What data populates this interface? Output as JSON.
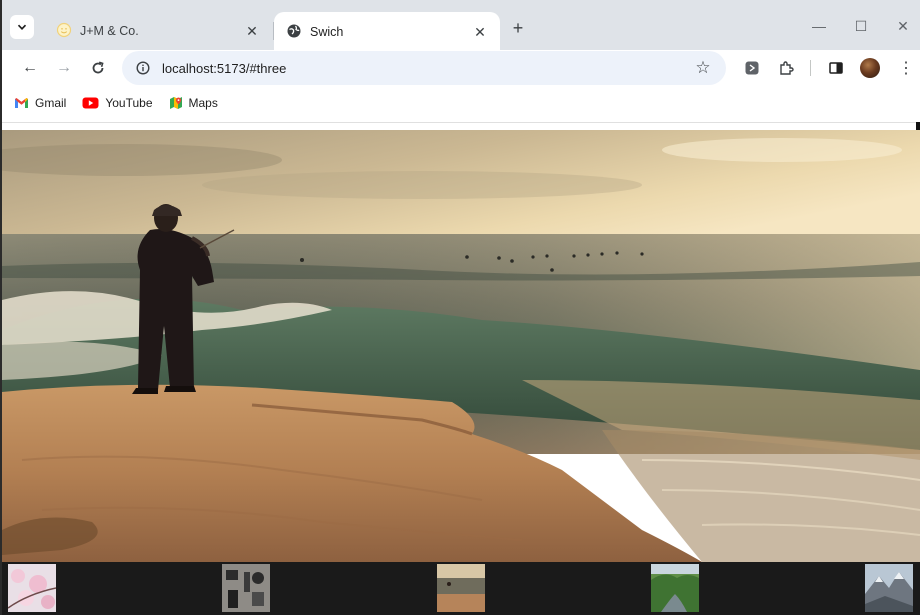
{
  "tabs": [
    {
      "title": "J+M & Co.",
      "active": false,
      "favicon": "smiley-favicon-icon"
    },
    {
      "title": "Swich",
      "active": true,
      "favicon": "globe-icon"
    }
  ],
  "toolbar": {
    "url": "localhost:5173/#three"
  },
  "bookmarks": [
    {
      "label": "Gmail",
      "icon": "gmail-icon"
    },
    {
      "label": "YouTube",
      "icon": "youtube-icon"
    },
    {
      "label": "Maps",
      "icon": "maps-icon"
    }
  ],
  "hero": {
    "subject": "fisherman-at-shore-sunset",
    "colors": {
      "sky": "#c9b48c",
      "sea": "#4f5f52",
      "sand": "#b9855a"
    }
  },
  "thumbnails": [
    {
      "name": "cherry-blossom"
    },
    {
      "name": "desk-items"
    },
    {
      "name": "fisherman-shore"
    },
    {
      "name": "green-valley"
    },
    {
      "name": "mountain-snow"
    }
  ]
}
